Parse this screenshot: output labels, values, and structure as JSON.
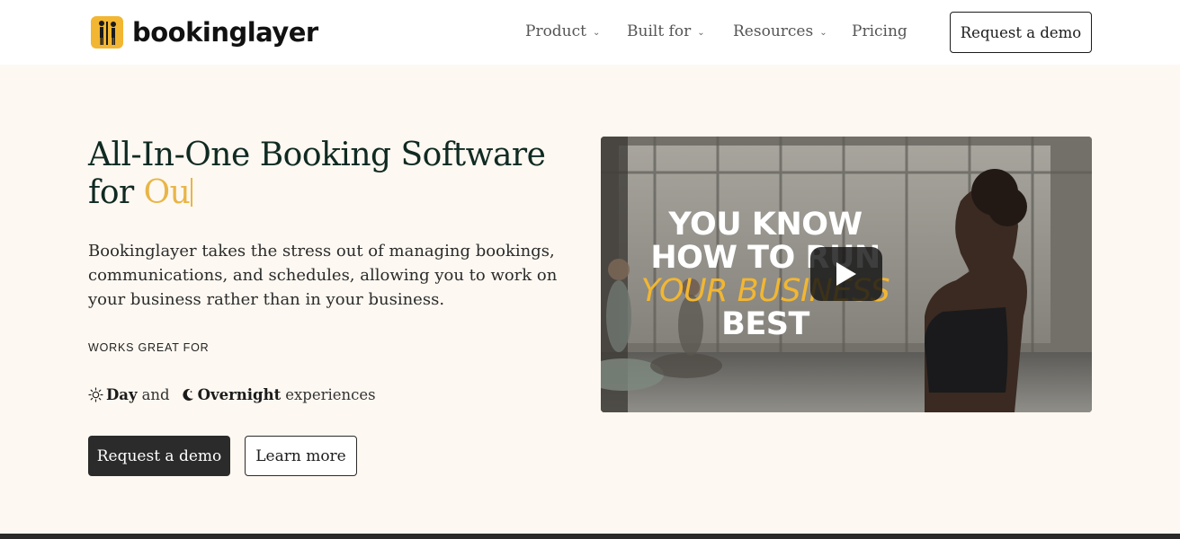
{
  "brand": {
    "name": "bookinglayer",
    "logo_color": "#f2b632"
  },
  "nav": {
    "items": [
      {
        "label": "Product",
        "has_dropdown": true
      },
      {
        "label": "Built for",
        "has_dropdown": true
      },
      {
        "label": "Resources",
        "has_dropdown": true
      },
      {
        "label": "Pricing",
        "has_dropdown": false
      }
    ],
    "cta_label": "Request a demo"
  },
  "hero": {
    "title_line1": "All-In-One Booking Software",
    "title_prefix": "for",
    "title_typed": "Ou",
    "description": "Bookinglayer takes the stress out of managing bookings, communications, and schedules, allowing you to work on your business rather than in your business.",
    "works_label": "WORKS GREAT FOR",
    "experiences": {
      "day": "Day",
      "and": "and",
      "overnight": "Overnight",
      "suffix": "experiences",
      "icons": [
        "sun-icon",
        "moon-icon"
      ]
    },
    "primary_button": "Request a demo",
    "secondary_button": "Learn more"
  },
  "video": {
    "line1": "YOU KNOW",
    "line2": "HOW TO RUN",
    "line3": "YOUR BUSINESS",
    "line4": "BEST",
    "highlight_color": "#f2b632",
    "play_icon": "play-icon"
  },
  "colors": {
    "accent": "#e9b547",
    "hero_bg": "#fdf8f1",
    "title_color": "#0f2a22",
    "dark_button": "#2b2b2b"
  }
}
